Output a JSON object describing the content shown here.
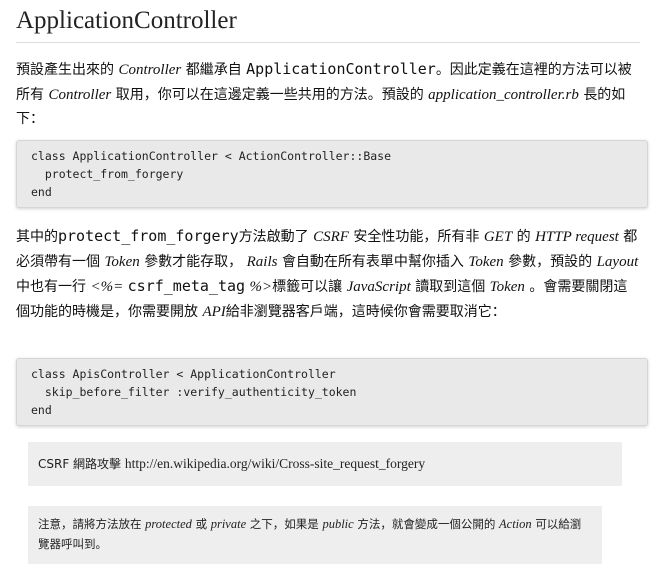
{
  "title": "ApplicationController",
  "para1": {
    "t1": "預設產生出來的",
    "i1": "Controller",
    "t2": "都繼承自",
    "c1": "ApplicationController",
    "t3": "。因此定義在這裡的方法可以被所有",
    "i2": "Controller",
    "t4": "取用，你可以在這邊定義一些共用的方法。預設的",
    "i3": "application_controller.rb",
    "t5": "長的如下："
  },
  "code1": "class ApplicationController < ActionController::Base\n  protect_from_forgery\nend",
  "para2": {
    "t1": "其中的",
    "c1": "protect_from_forgery",
    "t2": "方法啟動了",
    "i1": "CSRF",
    "t3": "安全性功能，所有非",
    "i2": "GET",
    "t4": "的",
    "i3": "HTTP request",
    "t5": "都必須帶有一個",
    "i4": "Token",
    "t6": "參數才能存取，",
    "i5": "Rails",
    "t7": "會自動在所有表單中幫你插入",
    "i6": "Token",
    "t8": "參數，預設的",
    "i7": "Layout",
    "t9": "中也有一行",
    "i8": "<%=",
    "c2": "csrf_meta_tag",
    "i9": "%>",
    "t10": "標籤可以讓",
    "i10": "JavaScript",
    "t11": "讀取到這個",
    "i11": "Token",
    "t12": "。會需要關閉這個功能的時機是，你需要開放",
    "i12": "API",
    "t13": "給非瀏覽器客戶端，這時候你會需要取消它："
  },
  "code2": "class ApisController < ApplicationController\n  skip_before_filter :verify_authenticity_token\nend",
  "note1": {
    "label": "CSRF 網路攻擊",
    "url": "http://en.wikipedia.org/wiki/Cross-site_request_forgery"
  },
  "note2": {
    "t1": "注意，請將方法放在",
    "i1": "protected",
    "t2": "或",
    "i2": "private",
    "t3": "之下，如果是",
    "i3": "public",
    "t4": "方法，就會變成一個公開的",
    "i4": "Action",
    "t5": "可以給瀏覽器呼叫到。"
  }
}
